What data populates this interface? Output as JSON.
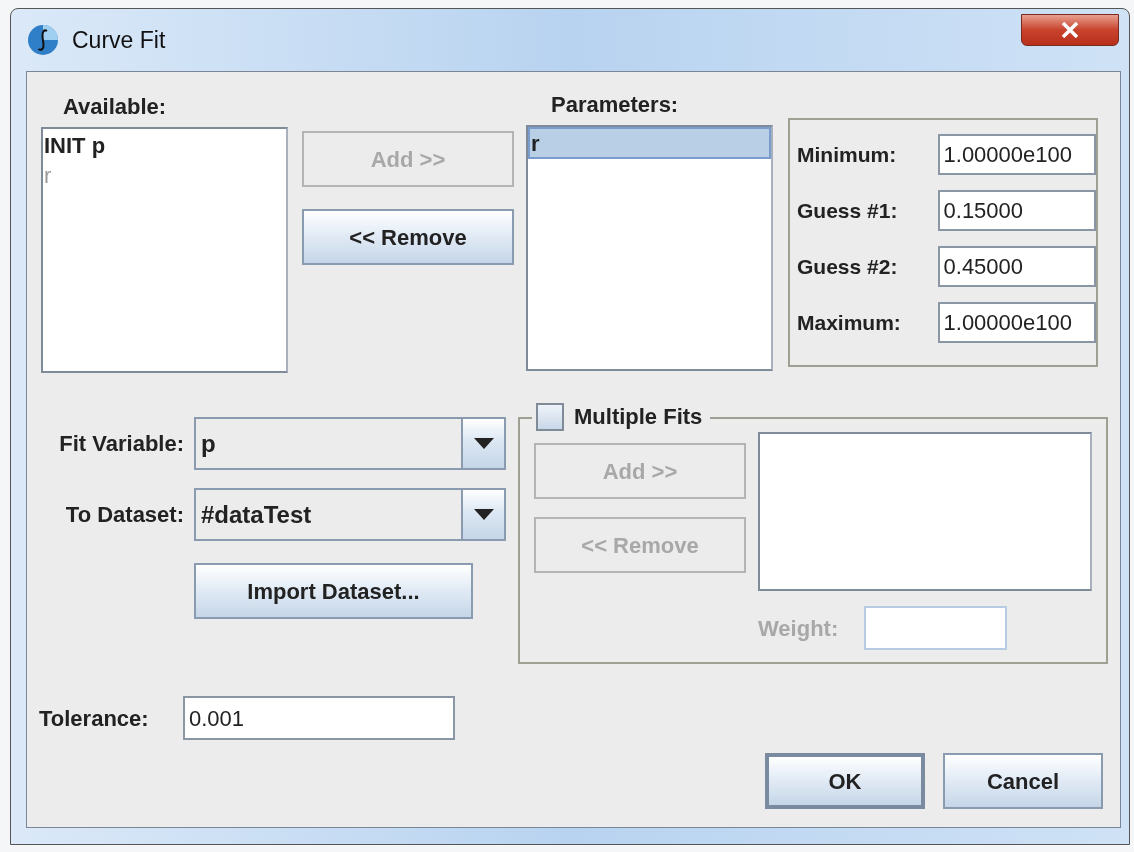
{
  "window": {
    "title": "Curve Fit"
  },
  "available": {
    "label": "Available:",
    "items": [
      {
        "text": "INIT p",
        "enabled": true
      },
      {
        "text": "r",
        "enabled": false
      }
    ]
  },
  "add_button": {
    "label": "Add >>",
    "disabled": true
  },
  "remove_button": {
    "label": "<< Remove",
    "disabled": false
  },
  "parameters": {
    "label": "Parameters:",
    "items": [
      {
        "text": "r",
        "selected": true
      }
    ]
  },
  "bounds": [
    {
      "label": "Minimum:",
      "value": "1.00000e100"
    },
    {
      "label": "Guess #1:",
      "value": "0.15000"
    },
    {
      "label": "Guess #2:",
      "value": "0.45000"
    },
    {
      "label": "Maximum:",
      "value": "1.00000e100"
    }
  ],
  "fit_variable": {
    "label": "Fit Variable:",
    "value": "p"
  },
  "to_dataset": {
    "label": "To Dataset:",
    "value": "#dataTest"
  },
  "import_button": {
    "label": "Import Dataset...",
    "disabled": false
  },
  "multiple_fits": {
    "label": "Multiple Fits",
    "checked": false,
    "add_button": {
      "label": "Add >>",
      "disabled": true
    },
    "remove_button": {
      "label": "<< Remove",
      "disabled": true
    },
    "weight": {
      "label": "Weight:",
      "disabled": true
    }
  },
  "tolerance": {
    "label": "Tolerance:",
    "value": "0.001"
  },
  "buttons": [
    {
      "label": "OK",
      "default": true
    },
    {
      "label": "Cancel",
      "default": false
    }
  ]
}
